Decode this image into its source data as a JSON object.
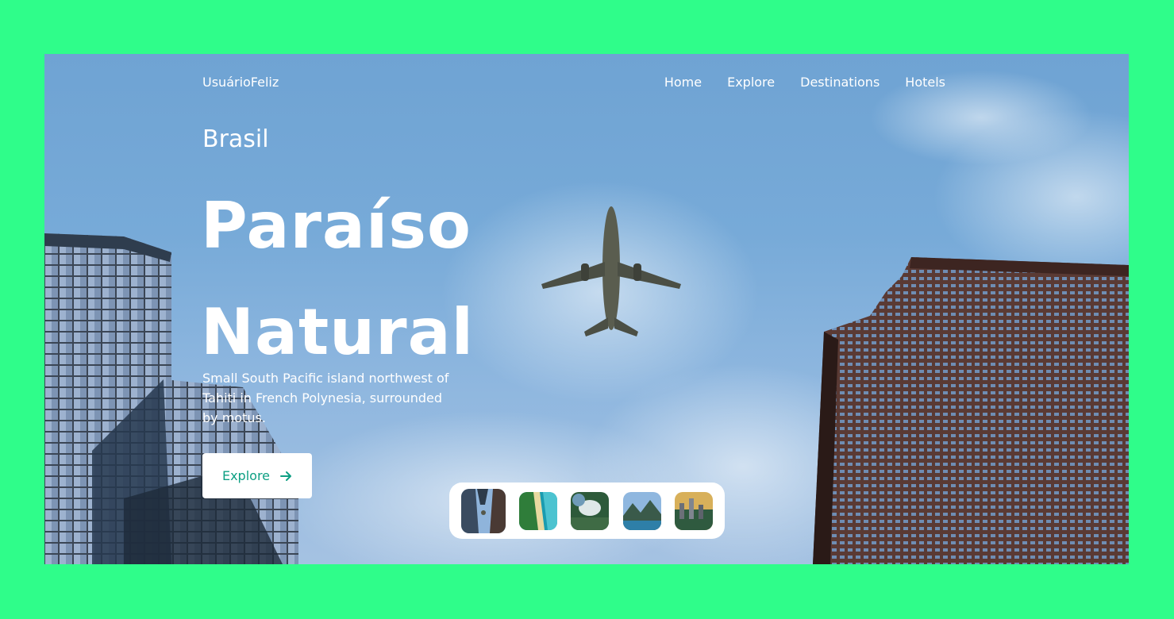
{
  "brand": "UsuárioFeliz",
  "nav": [
    "Home",
    "Explore",
    "Destinations",
    "Hotels"
  ],
  "hero": {
    "kicker": "Brasil",
    "title_line1": "Paraíso",
    "title_line2": "Natural",
    "description": "Small South Pacific island northwest of Tahiti in French Polynesia, surrounded by motus.",
    "cta_label": "Explore",
    "cta_icon": "arrow-right-icon"
  },
  "thumbnails": [
    {
      "name": "thumb-city-sky",
      "active": true
    },
    {
      "name": "thumb-beach"
    },
    {
      "name": "thumb-waterfall"
    },
    {
      "name": "thumb-coast-mountains"
    },
    {
      "name": "thumb-city-sunset"
    }
  ],
  "colors": {
    "background": "#2ffd8a",
    "accent": "#0e9f83",
    "sky": "#77aad8"
  }
}
